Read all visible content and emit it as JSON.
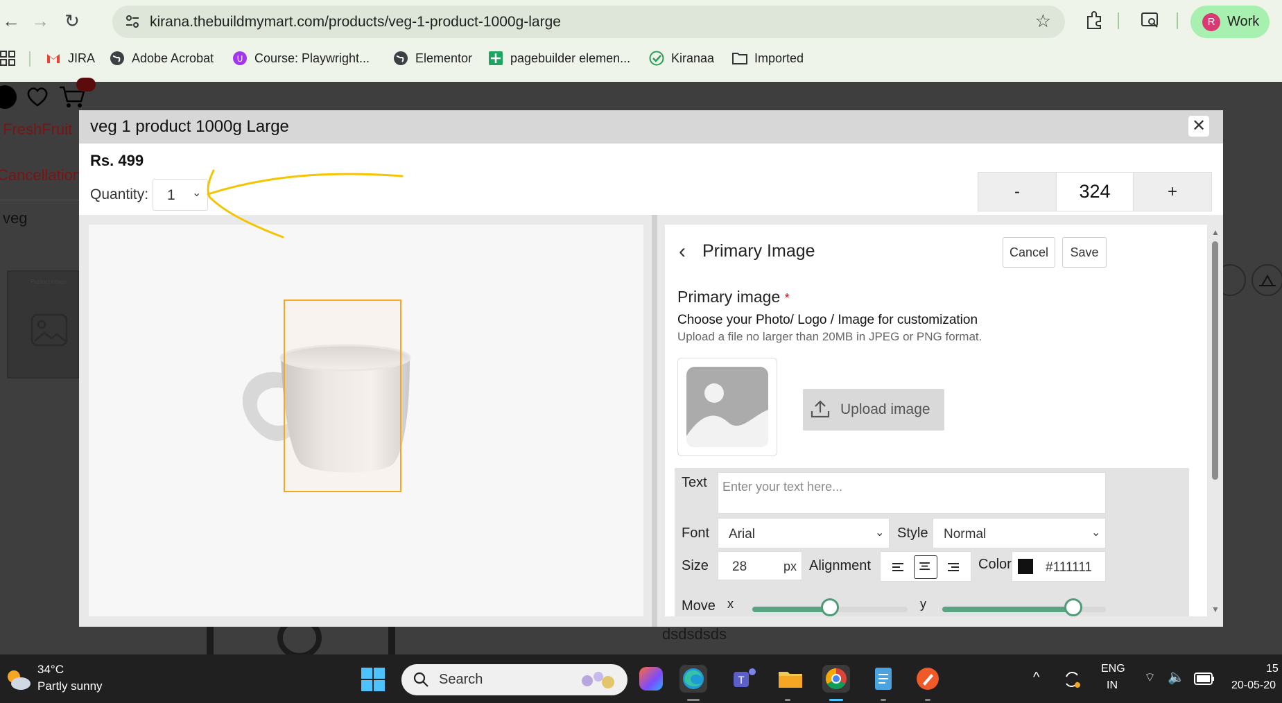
{
  "browser": {
    "url": "kirana.thebuildmymart.com/products/veg-1-product-1000g-large",
    "profile_initial": "R",
    "profile_label": "Work",
    "bookmarks": [
      "JIRA",
      "Adobe Acrobat",
      "Course: Playwright...",
      "Elementor",
      "pagebuilder elemen...",
      "Kiranaa",
      "Imported"
    ]
  },
  "background_page": {
    "brand_text": "FreshFruit",
    "cancellation_text": "Cancellation",
    "veg_text": "veg",
    "bottom_text": "dsdsdsds",
    "thumbnail_text": "Product Image"
  },
  "modal": {
    "title": "veg 1 product 1000g Large",
    "price": "Rs. 499",
    "quantity_label": "Quantity:",
    "quantity_value": "1",
    "stepper": {
      "minus": "-",
      "value": "324",
      "plus": "+"
    }
  },
  "panel": {
    "title": "Primary Image",
    "cancel_label": "Cancel",
    "save_label": "Save",
    "image_heading": "Primary image",
    "required_mark": "*",
    "image_description": "Choose your Photo/ Logo / Image for customization",
    "image_hint": "Upload a file no larger than 20MB in JPEG or PNG format.",
    "upload_label": "Upload image",
    "text_label": "Text",
    "text_placeholder": "Enter your text here...",
    "font_label": "Font",
    "font_value": "Arial",
    "style_label": "Style",
    "style_value": "Normal",
    "size_label": "Size",
    "size_value": "28",
    "size_unit": "px",
    "alignment_label": "Alignment",
    "alignment_selected": "center",
    "color_label": "Color",
    "color_value": "#111111",
    "move_label": "Move",
    "move_x_label": "x",
    "move_y_label": "y",
    "move_x_level": 0.5,
    "move_y_level": 0.8
  },
  "taskbar": {
    "temperature": "34°C",
    "weather": "Partly sunny",
    "search_label": "Search",
    "language_top": "ENG",
    "language_bottom": "IN",
    "time_partial": "15",
    "date_partial": "20-05-20"
  },
  "colors": {
    "accent_green": "#5aa581",
    "selection_orange": "#f5a623",
    "annotation_yellow": "#f5c400"
  }
}
